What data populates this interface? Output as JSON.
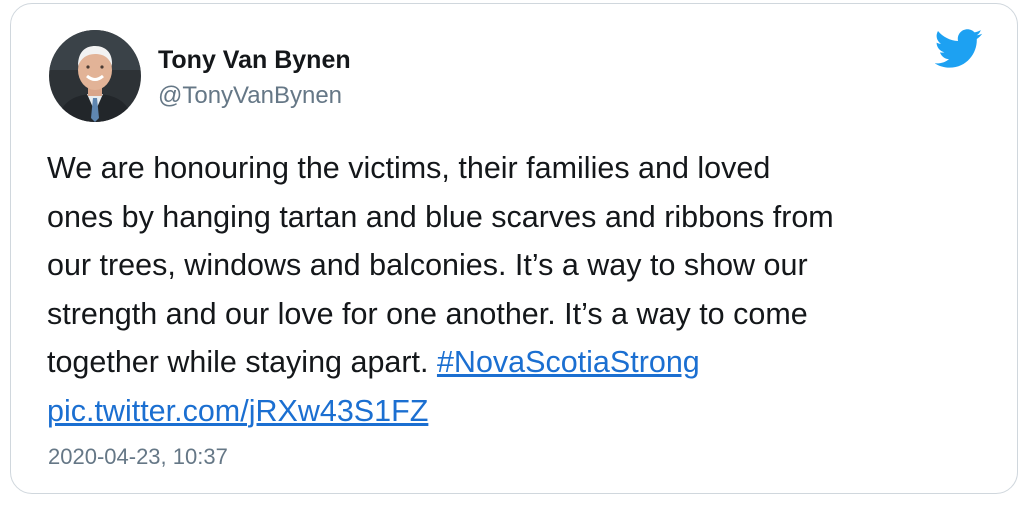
{
  "tweet": {
    "author_name": "Tony Van Bynen",
    "author_handle": "@TonyVanBynen",
    "text_lines": [
      "We are honouring the victims, their families and loved",
      "ones by hanging tartan and blue scarves and ribbons from",
      "our trees, windows and balconies. It’s a way to show our",
      "strength and our love for one another. It’s a way to come",
      "together while staying apart. "
    ],
    "hashtag": "#NovaScotiaStrong",
    "media_link": "pic.twitter.com/jRXw43S1FZ",
    "timestamp": "2020-04-23, 10:37"
  },
  "icons": {
    "avatar": "avatar",
    "brand": "twitter-bird-icon"
  },
  "colors": {
    "link": "#1b6fd1",
    "twitter_blue": "#1da1f2",
    "secondary_text": "#657786",
    "border": "#d0d7dd"
  }
}
